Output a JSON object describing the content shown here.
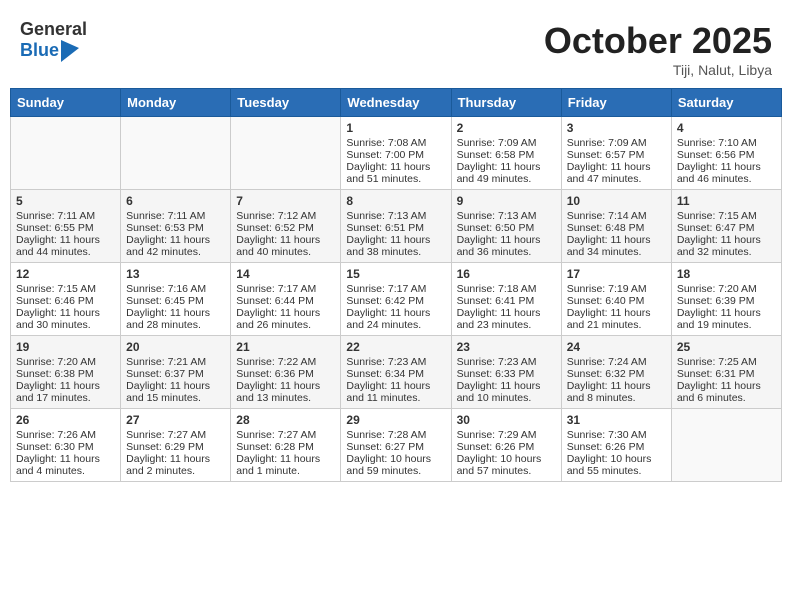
{
  "header": {
    "logo_general": "General",
    "logo_blue": "Blue",
    "month": "October 2025",
    "location": "Tiji, Nalut, Libya"
  },
  "days_of_week": [
    "Sunday",
    "Monday",
    "Tuesday",
    "Wednesday",
    "Thursday",
    "Friday",
    "Saturday"
  ],
  "weeks": [
    [
      {
        "day": "",
        "sunrise": "",
        "sunset": "",
        "daylight": ""
      },
      {
        "day": "",
        "sunrise": "",
        "sunset": "",
        "daylight": ""
      },
      {
        "day": "",
        "sunrise": "",
        "sunset": "",
        "daylight": ""
      },
      {
        "day": "1",
        "sunrise": "Sunrise: 7:08 AM",
        "sunset": "Sunset: 7:00 PM",
        "daylight": "Daylight: 11 hours and 51 minutes."
      },
      {
        "day": "2",
        "sunrise": "Sunrise: 7:09 AM",
        "sunset": "Sunset: 6:58 PM",
        "daylight": "Daylight: 11 hours and 49 minutes."
      },
      {
        "day": "3",
        "sunrise": "Sunrise: 7:09 AM",
        "sunset": "Sunset: 6:57 PM",
        "daylight": "Daylight: 11 hours and 47 minutes."
      },
      {
        "day": "4",
        "sunrise": "Sunrise: 7:10 AM",
        "sunset": "Sunset: 6:56 PM",
        "daylight": "Daylight: 11 hours and 46 minutes."
      }
    ],
    [
      {
        "day": "5",
        "sunrise": "Sunrise: 7:11 AM",
        "sunset": "Sunset: 6:55 PM",
        "daylight": "Daylight: 11 hours and 44 minutes."
      },
      {
        "day": "6",
        "sunrise": "Sunrise: 7:11 AM",
        "sunset": "Sunset: 6:53 PM",
        "daylight": "Daylight: 11 hours and 42 minutes."
      },
      {
        "day": "7",
        "sunrise": "Sunrise: 7:12 AM",
        "sunset": "Sunset: 6:52 PM",
        "daylight": "Daylight: 11 hours and 40 minutes."
      },
      {
        "day": "8",
        "sunrise": "Sunrise: 7:13 AM",
        "sunset": "Sunset: 6:51 PM",
        "daylight": "Daylight: 11 hours and 38 minutes."
      },
      {
        "day": "9",
        "sunrise": "Sunrise: 7:13 AM",
        "sunset": "Sunset: 6:50 PM",
        "daylight": "Daylight: 11 hours and 36 minutes."
      },
      {
        "day": "10",
        "sunrise": "Sunrise: 7:14 AM",
        "sunset": "Sunset: 6:48 PM",
        "daylight": "Daylight: 11 hours and 34 minutes."
      },
      {
        "day": "11",
        "sunrise": "Sunrise: 7:15 AM",
        "sunset": "Sunset: 6:47 PM",
        "daylight": "Daylight: 11 hours and 32 minutes."
      }
    ],
    [
      {
        "day": "12",
        "sunrise": "Sunrise: 7:15 AM",
        "sunset": "Sunset: 6:46 PM",
        "daylight": "Daylight: 11 hours and 30 minutes."
      },
      {
        "day": "13",
        "sunrise": "Sunrise: 7:16 AM",
        "sunset": "Sunset: 6:45 PM",
        "daylight": "Daylight: 11 hours and 28 minutes."
      },
      {
        "day": "14",
        "sunrise": "Sunrise: 7:17 AM",
        "sunset": "Sunset: 6:44 PM",
        "daylight": "Daylight: 11 hours and 26 minutes."
      },
      {
        "day": "15",
        "sunrise": "Sunrise: 7:17 AM",
        "sunset": "Sunset: 6:42 PM",
        "daylight": "Daylight: 11 hours and 24 minutes."
      },
      {
        "day": "16",
        "sunrise": "Sunrise: 7:18 AM",
        "sunset": "Sunset: 6:41 PM",
        "daylight": "Daylight: 11 hours and 23 minutes."
      },
      {
        "day": "17",
        "sunrise": "Sunrise: 7:19 AM",
        "sunset": "Sunset: 6:40 PM",
        "daylight": "Daylight: 11 hours and 21 minutes."
      },
      {
        "day": "18",
        "sunrise": "Sunrise: 7:20 AM",
        "sunset": "Sunset: 6:39 PM",
        "daylight": "Daylight: 11 hours and 19 minutes."
      }
    ],
    [
      {
        "day": "19",
        "sunrise": "Sunrise: 7:20 AM",
        "sunset": "Sunset: 6:38 PM",
        "daylight": "Daylight: 11 hours and 17 minutes."
      },
      {
        "day": "20",
        "sunrise": "Sunrise: 7:21 AM",
        "sunset": "Sunset: 6:37 PM",
        "daylight": "Daylight: 11 hours and 15 minutes."
      },
      {
        "day": "21",
        "sunrise": "Sunrise: 7:22 AM",
        "sunset": "Sunset: 6:36 PM",
        "daylight": "Daylight: 11 hours and 13 minutes."
      },
      {
        "day": "22",
        "sunrise": "Sunrise: 7:23 AM",
        "sunset": "Sunset: 6:34 PM",
        "daylight": "Daylight: 11 hours and 11 minutes."
      },
      {
        "day": "23",
        "sunrise": "Sunrise: 7:23 AM",
        "sunset": "Sunset: 6:33 PM",
        "daylight": "Daylight: 11 hours and 10 minutes."
      },
      {
        "day": "24",
        "sunrise": "Sunrise: 7:24 AM",
        "sunset": "Sunset: 6:32 PM",
        "daylight": "Daylight: 11 hours and 8 minutes."
      },
      {
        "day": "25",
        "sunrise": "Sunrise: 7:25 AM",
        "sunset": "Sunset: 6:31 PM",
        "daylight": "Daylight: 11 hours and 6 minutes."
      }
    ],
    [
      {
        "day": "26",
        "sunrise": "Sunrise: 7:26 AM",
        "sunset": "Sunset: 6:30 PM",
        "daylight": "Daylight: 11 hours and 4 minutes."
      },
      {
        "day": "27",
        "sunrise": "Sunrise: 7:27 AM",
        "sunset": "Sunset: 6:29 PM",
        "daylight": "Daylight: 11 hours and 2 minutes."
      },
      {
        "day": "28",
        "sunrise": "Sunrise: 7:27 AM",
        "sunset": "Sunset: 6:28 PM",
        "daylight": "Daylight: 11 hours and 1 minute."
      },
      {
        "day": "29",
        "sunrise": "Sunrise: 7:28 AM",
        "sunset": "Sunset: 6:27 PM",
        "daylight": "Daylight: 10 hours and 59 minutes."
      },
      {
        "day": "30",
        "sunrise": "Sunrise: 7:29 AM",
        "sunset": "Sunset: 6:26 PM",
        "daylight": "Daylight: 10 hours and 57 minutes."
      },
      {
        "day": "31",
        "sunrise": "Sunrise: 7:30 AM",
        "sunset": "Sunset: 6:26 PM",
        "daylight": "Daylight: 10 hours and 55 minutes."
      },
      {
        "day": "",
        "sunrise": "",
        "sunset": "",
        "daylight": ""
      }
    ]
  ]
}
